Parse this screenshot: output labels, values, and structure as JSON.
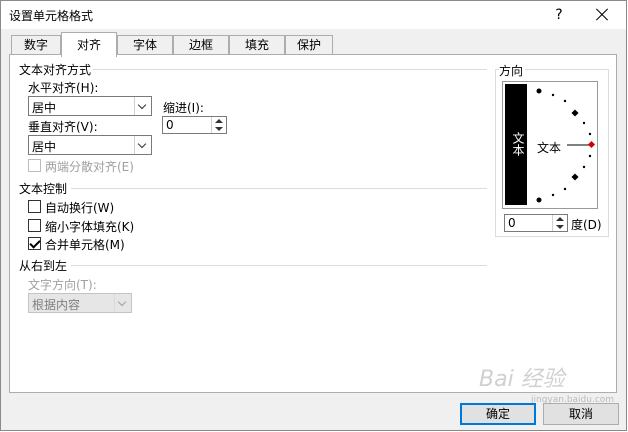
{
  "window": {
    "title": "设置单元格格式",
    "help": "?"
  },
  "tabs": [
    {
      "label": "数字",
      "active": false
    },
    {
      "label": "对齐",
      "active": true
    },
    {
      "label": "字体",
      "active": false
    },
    {
      "label": "边框",
      "active": false
    },
    {
      "label": "填充",
      "active": false
    },
    {
      "label": "保护",
      "active": false
    }
  ],
  "alignment": {
    "section_title": "文本对齐方式",
    "horizontal_label": "水平对齐(H):",
    "horizontal_value": "居中",
    "vertical_label": "垂直对齐(V):",
    "vertical_value": "居中",
    "indent_label": "缩进(I):",
    "indent_value": "0",
    "distributed_label": "两端分散对齐(E)"
  },
  "text_control": {
    "section_title": "文本控制",
    "wrap_label": "自动换行(W)",
    "wrap_checked": false,
    "shrink_label": "缩小字体填充(K)",
    "shrink_checked": false,
    "merge_label": "合并单元格(M)",
    "merge_checked": true
  },
  "rtl": {
    "section_title": "从右到左",
    "direction_label": "文字方向(T):",
    "direction_value": "根据内容"
  },
  "orientation": {
    "section_title": "方向",
    "vertical_text": "文本",
    "text_label": "文本",
    "degree_value": "0",
    "degree_label": "度(D)",
    "accent_color": "#d00000"
  },
  "buttons": {
    "ok": "确定",
    "cancel": "取消"
  },
  "watermark": {
    "text": "Bai 经验",
    "sub": "jingyan.baidu.com"
  },
  "icons": {
    "close": "close-icon",
    "help": "help-icon"
  },
  "colors": {
    "default_button_border": "#0078d7",
    "dialog_bg": "#f0f0f0"
  }
}
